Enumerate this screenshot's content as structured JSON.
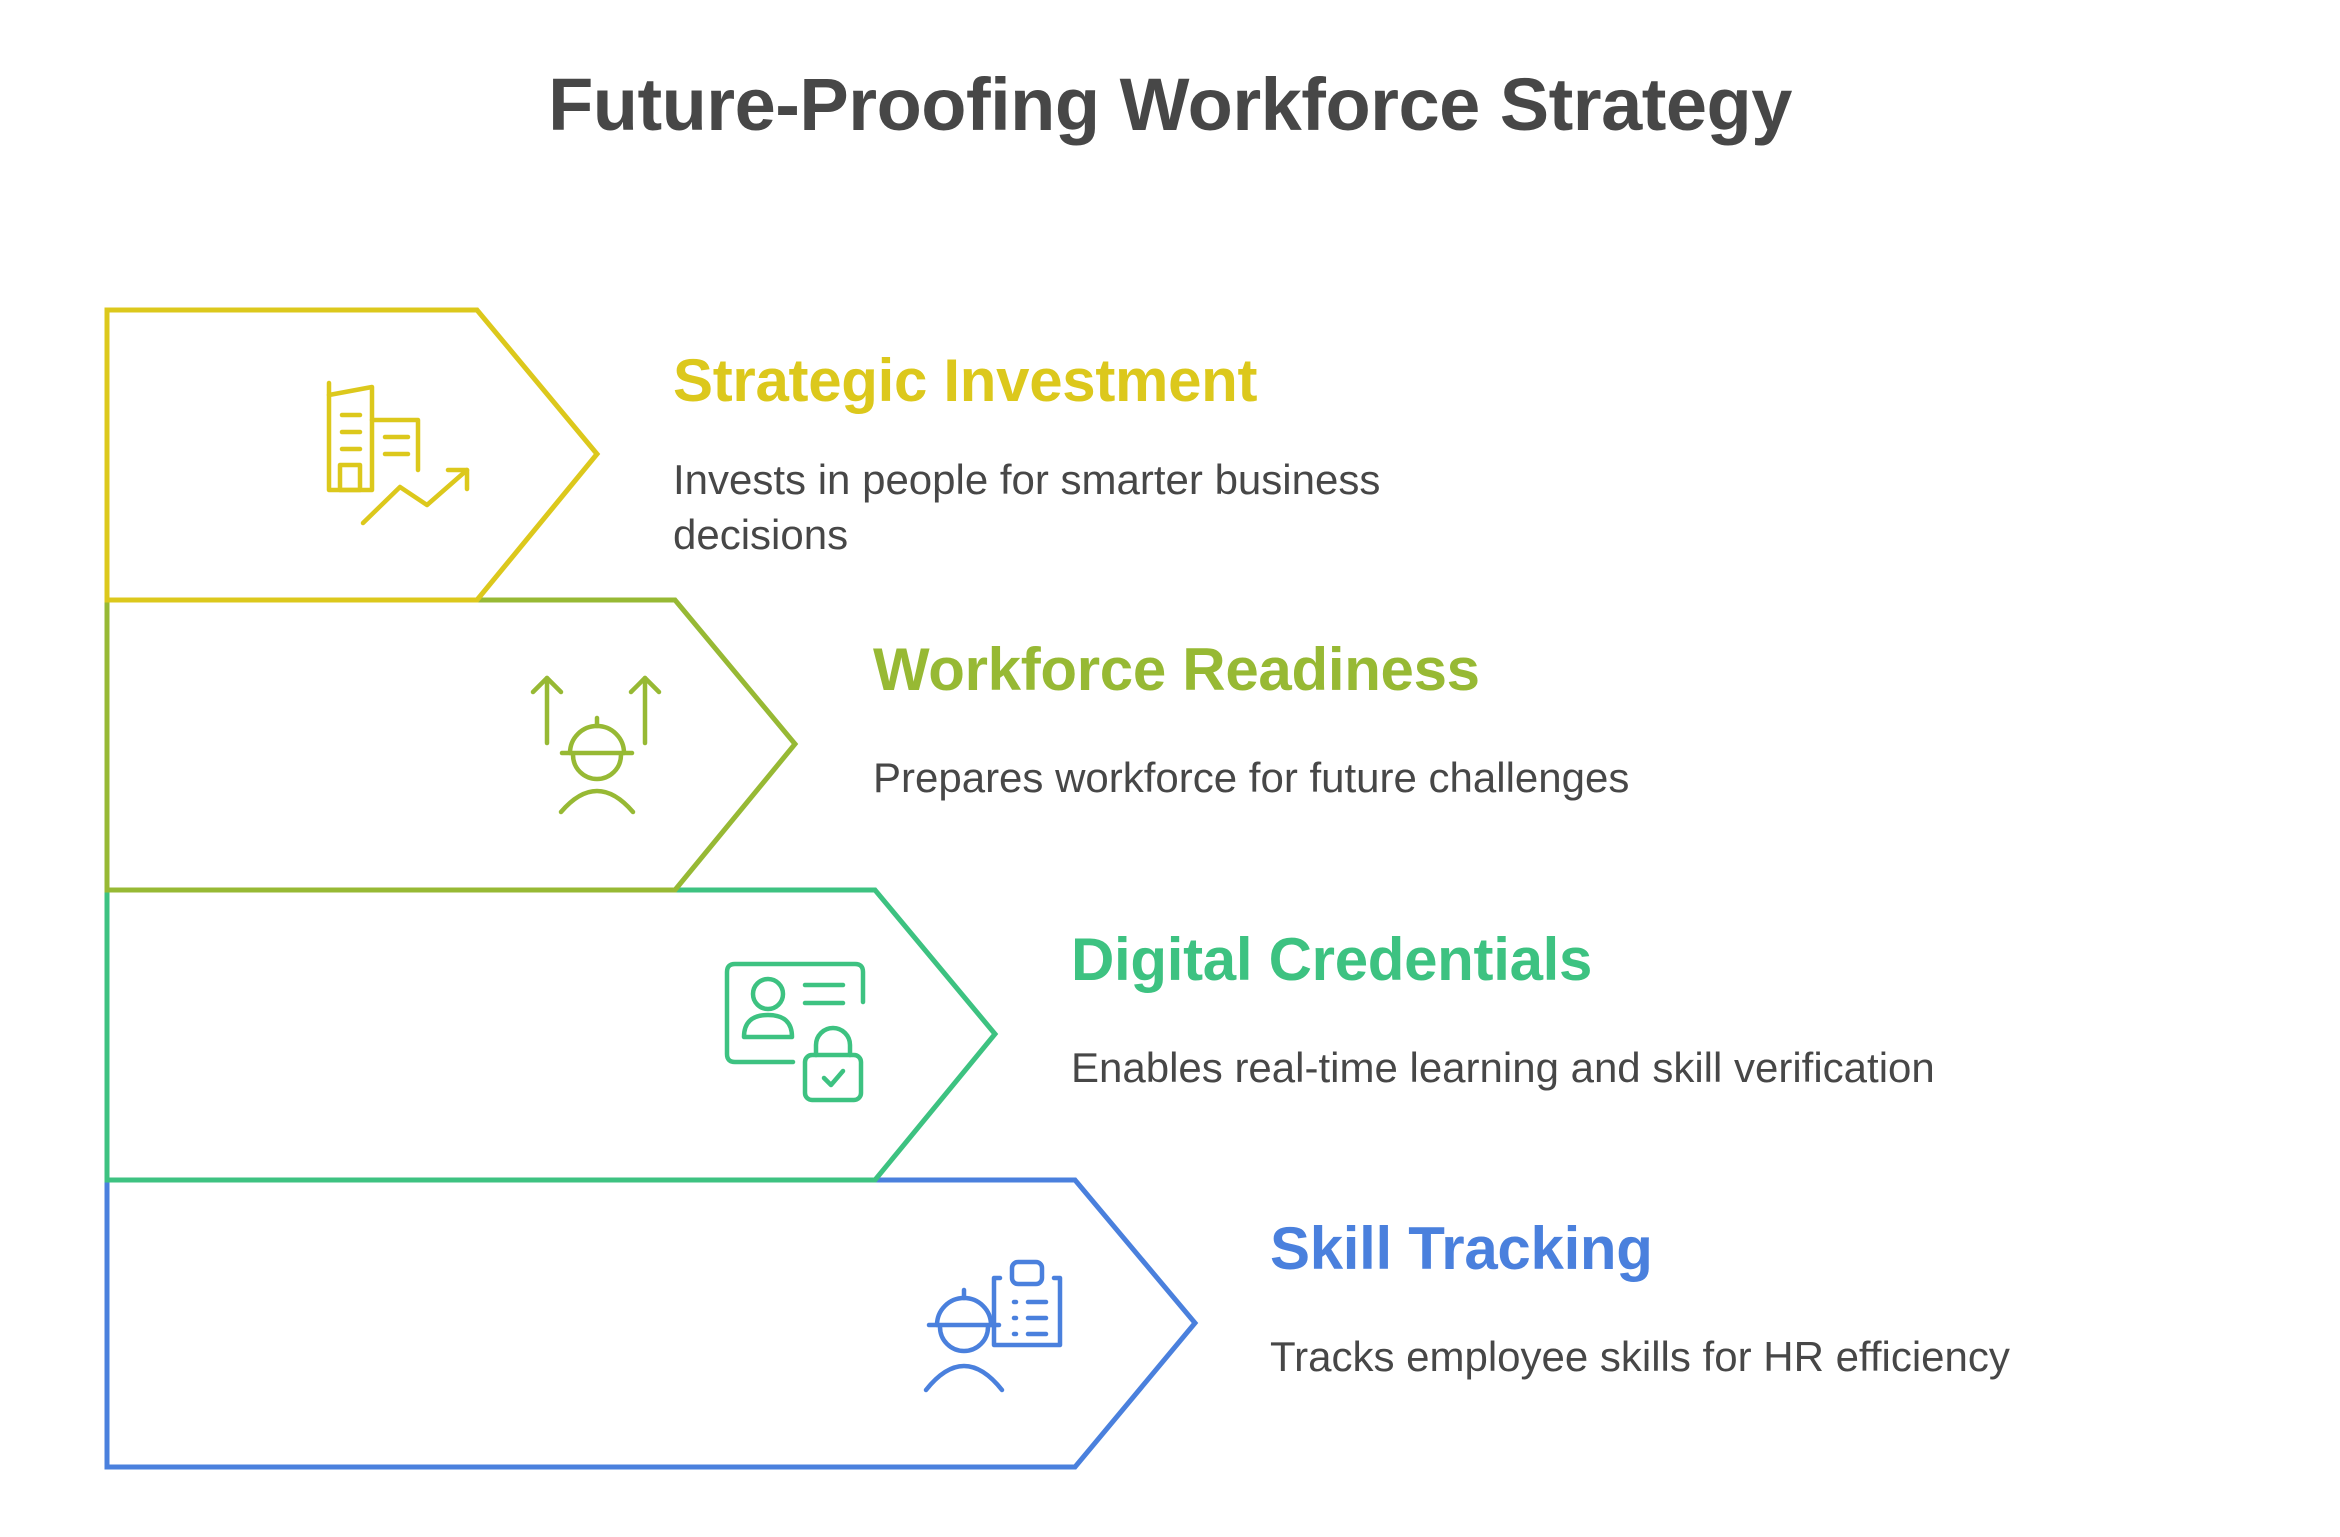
{
  "title": "Future-Proofing Workforce Strategy",
  "colors": {
    "title": "#474747",
    "text": "#474747",
    "step1": "#DCC81C",
    "step2": "#97B934",
    "step3": "#3DC281",
    "step4": "#4A80DD"
  },
  "steps": [
    {
      "title": "Strategic Investment",
      "description": "Invests in people for smarter business decisions",
      "icon": "buildings-growth-icon"
    },
    {
      "title": "Workforce Readiness",
      "description": "Prepares workforce for future challenges",
      "icon": "worker-arrows-up-icon"
    },
    {
      "title": "Digital Credentials",
      "description": "Enables real-time learning and skill verification",
      "icon": "id-card-lock-icon"
    },
    {
      "title": "Skill Tracking",
      "description": "Tracks employee skills for HR efficiency",
      "icon": "worker-clipboard-icon"
    }
  ]
}
